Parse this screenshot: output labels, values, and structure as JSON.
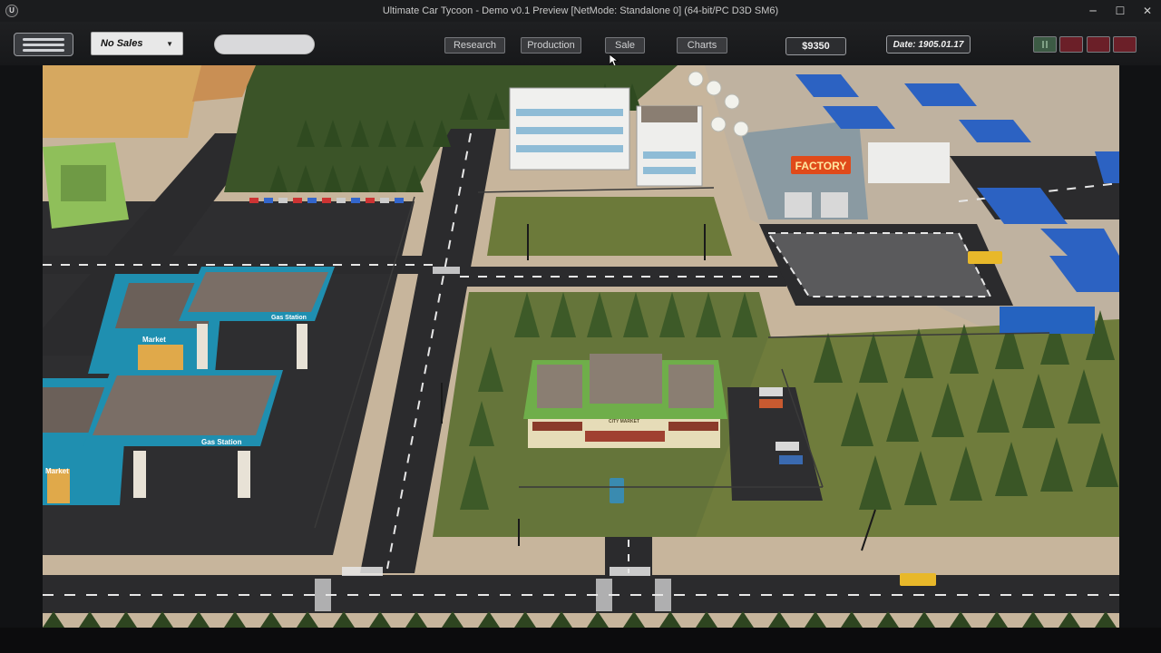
{
  "window": {
    "title": "Ultimate Car Tycoon - Demo v0.1 Preview [NetMode: Standalone 0]  (64-bit/PC D3D SM6)",
    "app_icon": "unreal-logo-icon",
    "controls": {
      "minimize": "─",
      "maximize": "☐",
      "close": "✕"
    }
  },
  "toolbar": {
    "menu_icon": "hamburger-menu-icon",
    "sales_dropdown": {
      "selected": "No Sales",
      "caret": "▼"
    },
    "search_value": "",
    "tabs": [
      {
        "label": "Research"
      },
      {
        "label": "Production"
      },
      {
        "label": "Sale"
      },
      {
        "label": "Charts"
      }
    ],
    "money": "$9350",
    "date": "Date: 1905.01.17",
    "speed_controls": [
      {
        "name": "pause-button",
        "color": "#3c5a44"
      },
      {
        "name": "speed-1-button",
        "color": "#6b1f28"
      },
      {
        "name": "speed-2-button",
        "color": "#6b1f28"
      },
      {
        "name": "speed-3-button",
        "color": "#6b1f28"
      }
    ]
  },
  "scene": {
    "signs": {
      "factory": "FACTORY",
      "market_top": "Market",
      "gas_top": "Gas Station",
      "market_bottom": "Market",
      "gas_bottom": "Gas Station",
      "supermarket": "CITY MARKET"
    },
    "colors": {
      "grass": "#6c7a3a",
      "road": "#2b2b2d",
      "sidewalk": "#c7b59c",
      "tree": "#3f5a2a",
      "factory_sign": "#e04a1a",
      "gas_blue": "#1f8fb0"
    }
  }
}
